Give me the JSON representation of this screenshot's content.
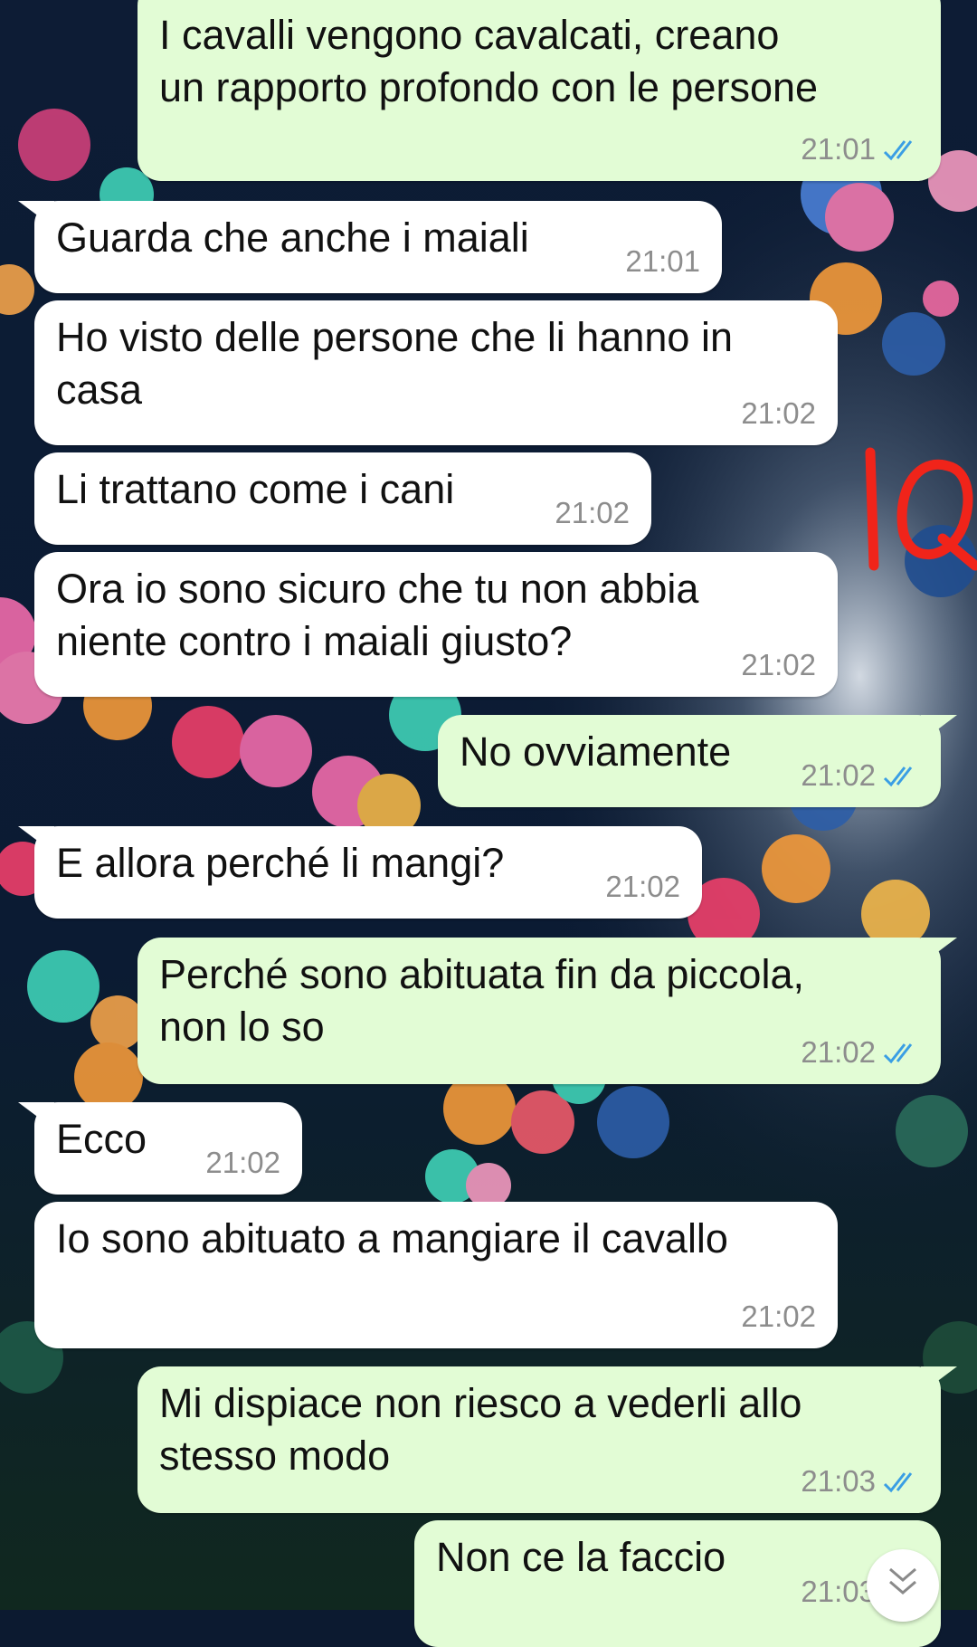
{
  "chat": {
    "messages": [
      {
        "direction": "out",
        "text": "I cavalli vengono cavalcati, creano\nun rapporto profondo con le persone",
        "time": "21:01",
        "read": true
      },
      {
        "direction": "in",
        "text": "Guarda che anche i maiali",
        "time": "21:01"
      },
      {
        "direction": "in",
        "text": "Ho visto delle persone che li hanno in\ncasa",
        "time": "21:02"
      },
      {
        "direction": "in",
        "text": "Li trattano come i cani",
        "time": "21:02"
      },
      {
        "direction": "in",
        "text": "Ora io sono sicuro che tu non abbia\nniente contro i maiali giusto?",
        "time": "21:02"
      },
      {
        "direction": "out",
        "text": "No ovviamente",
        "time": "21:02",
        "read": true
      },
      {
        "direction": "in",
        "text": "E allora perché li mangi?",
        "time": "21:02"
      },
      {
        "direction": "out",
        "text": "Perché sono abituata fin da piccola,\nnon lo so",
        "time": "21:02",
        "read": true
      },
      {
        "direction": "in",
        "text": "Ecco",
        "time": "21:02"
      },
      {
        "direction": "in",
        "text": "Io sono abituato a mangiare il cavallo",
        "time": "21:02"
      },
      {
        "direction": "out",
        "text": "Mi dispiace non riesco a vederli allo\nstesso modo",
        "time": "21:03",
        "read": true
      },
      {
        "direction": "out",
        "text": "Non ce la faccio",
        "time": "21:03",
        "read": true
      }
    ]
  },
  "annotation": {
    "text": "IQ",
    "color": "#f0241a"
  },
  "colors": {
    "incoming_bubble": "#ffffff",
    "outgoing_bubble": "#e2fcd5",
    "read_check": "#3a9ee4",
    "time": "#8d8d8d"
  },
  "icons": {
    "read_receipt": "double-check-icon",
    "scroll": "chevron-down-icon"
  }
}
